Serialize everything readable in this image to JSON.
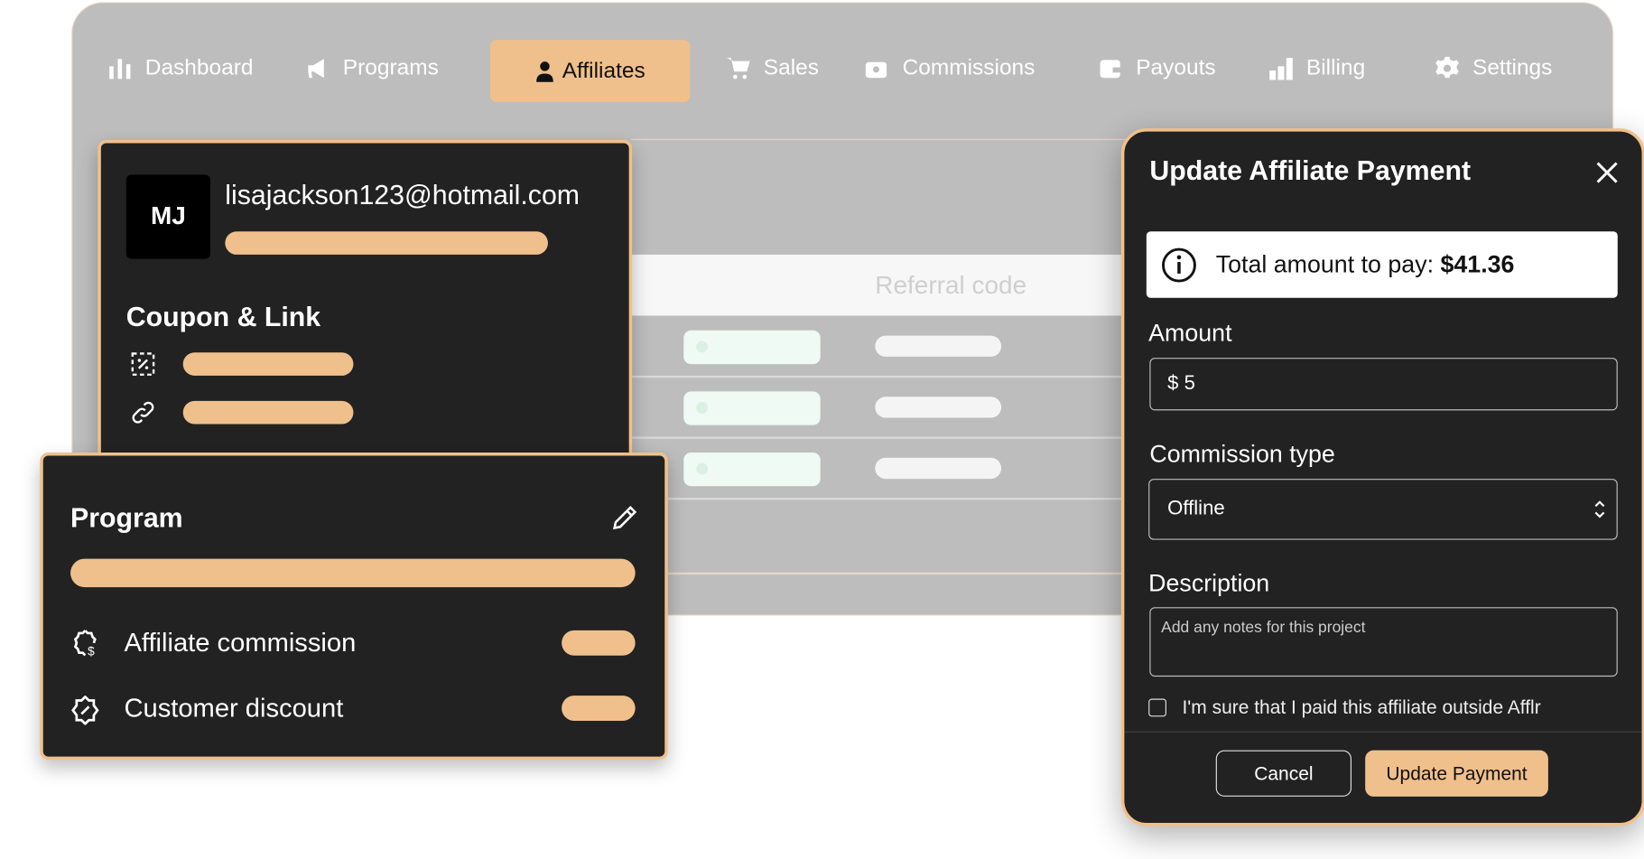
{
  "nav": {
    "items": [
      {
        "label": "Dashboard",
        "icon": "bar-chart-icon"
      },
      {
        "label": "Programs",
        "icon": "megaphone-icon"
      },
      {
        "label": "Affiliates",
        "icon": "user-icon",
        "active": true
      },
      {
        "label": "Sales",
        "icon": "cart-icon"
      },
      {
        "label": "Commissions",
        "icon": "money-icon"
      },
      {
        "label": "Payouts",
        "icon": "wallet-icon"
      },
      {
        "label": "Billing",
        "icon": "billing-icon"
      },
      {
        "label": "Settings",
        "icon": "gear-icon"
      }
    ]
  },
  "table": {
    "header": "Referral code"
  },
  "affiliate_card": {
    "avatar": "MJ",
    "email": "lisajackson123@hotmail.com",
    "section": "Coupon & Link"
  },
  "program_card": {
    "title": "Program",
    "rows": [
      "Affiliate commission",
      "Customer discount"
    ]
  },
  "modal": {
    "title": "Update Affiliate Payment",
    "info_label": "Total amount to pay: ",
    "info_amount": "$41.36",
    "amount_label": "Amount",
    "amount_value": "$ 5",
    "commission_type_label": "Commission type",
    "commission_type_value": "Offline",
    "description_label": "Description",
    "description_placeholder": "Add any notes for this project",
    "checkbox_label": "I'm sure that I paid this affiliate outside Afflr",
    "checkbox_checked": false,
    "cancel": "Cancel",
    "submit": "Update Payment"
  },
  "colors": {
    "accent": "#f0c08c",
    "card": "#222222",
    "panel": "#bdbdbd"
  }
}
